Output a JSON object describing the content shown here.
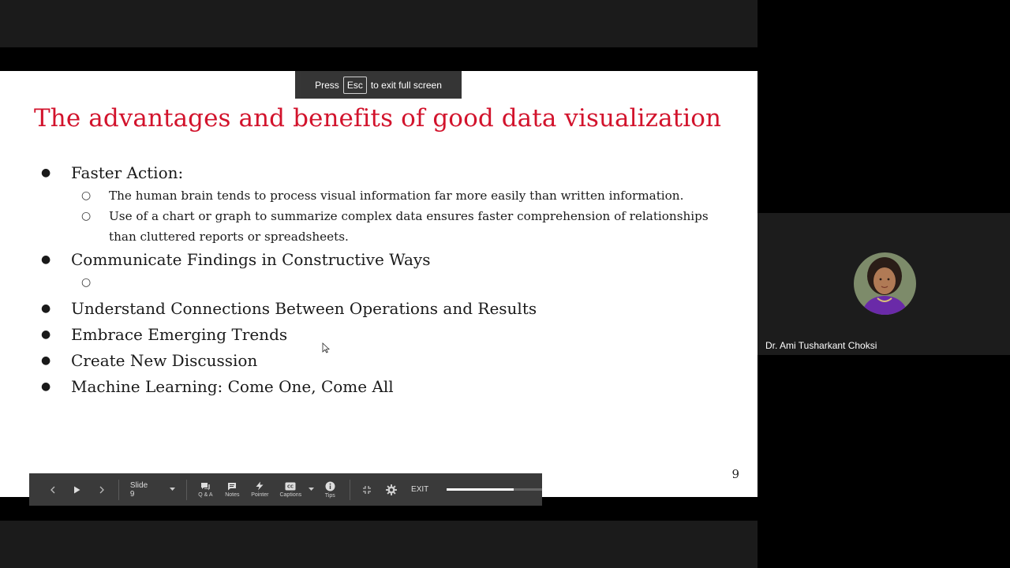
{
  "banner": {
    "press": "Press",
    "key": "Esc",
    "suffix": "to exit full screen"
  },
  "slide": {
    "title": "The advantages and benefits of good data visualization",
    "page_number": "9",
    "bullets": [
      {
        "text": "Faster Action:",
        "subs": [
          "The human brain tends to process visual information far more easily than written information.",
          "Use of a chart or graph to summarize complex data ensures faster comprehension of relationships than cluttered reports or spreadsheets."
        ]
      },
      {
        "text": "Communicate Findings in Constructive Ways",
        "subs": [
          ""
        ]
      },
      {
        "text": "Understand Connections Between Operations and Results",
        "subs": []
      },
      {
        "text": "Embrace Emerging Trends",
        "subs": []
      },
      {
        "text": "Create New Discussion",
        "subs": []
      },
      {
        "text": "Machine Learning: Come One, Come All",
        "subs": []
      }
    ],
    "sub_bullet_glyph": "○"
  },
  "toolbar": {
    "slide_select": "Slide 9",
    "qa": "Q & A",
    "notes": "Notes",
    "pointer": "Pointer",
    "captions": "Captions",
    "tips": "Tips",
    "exit": "EXIT",
    "progress_fraction": 0.7
  },
  "participant": {
    "name": "Dr. Ami Tusharkant Choksi"
  },
  "colors": {
    "title": "#d2132c",
    "toolbar": "#3a3a3a",
    "panel": "#1c1c1c"
  }
}
